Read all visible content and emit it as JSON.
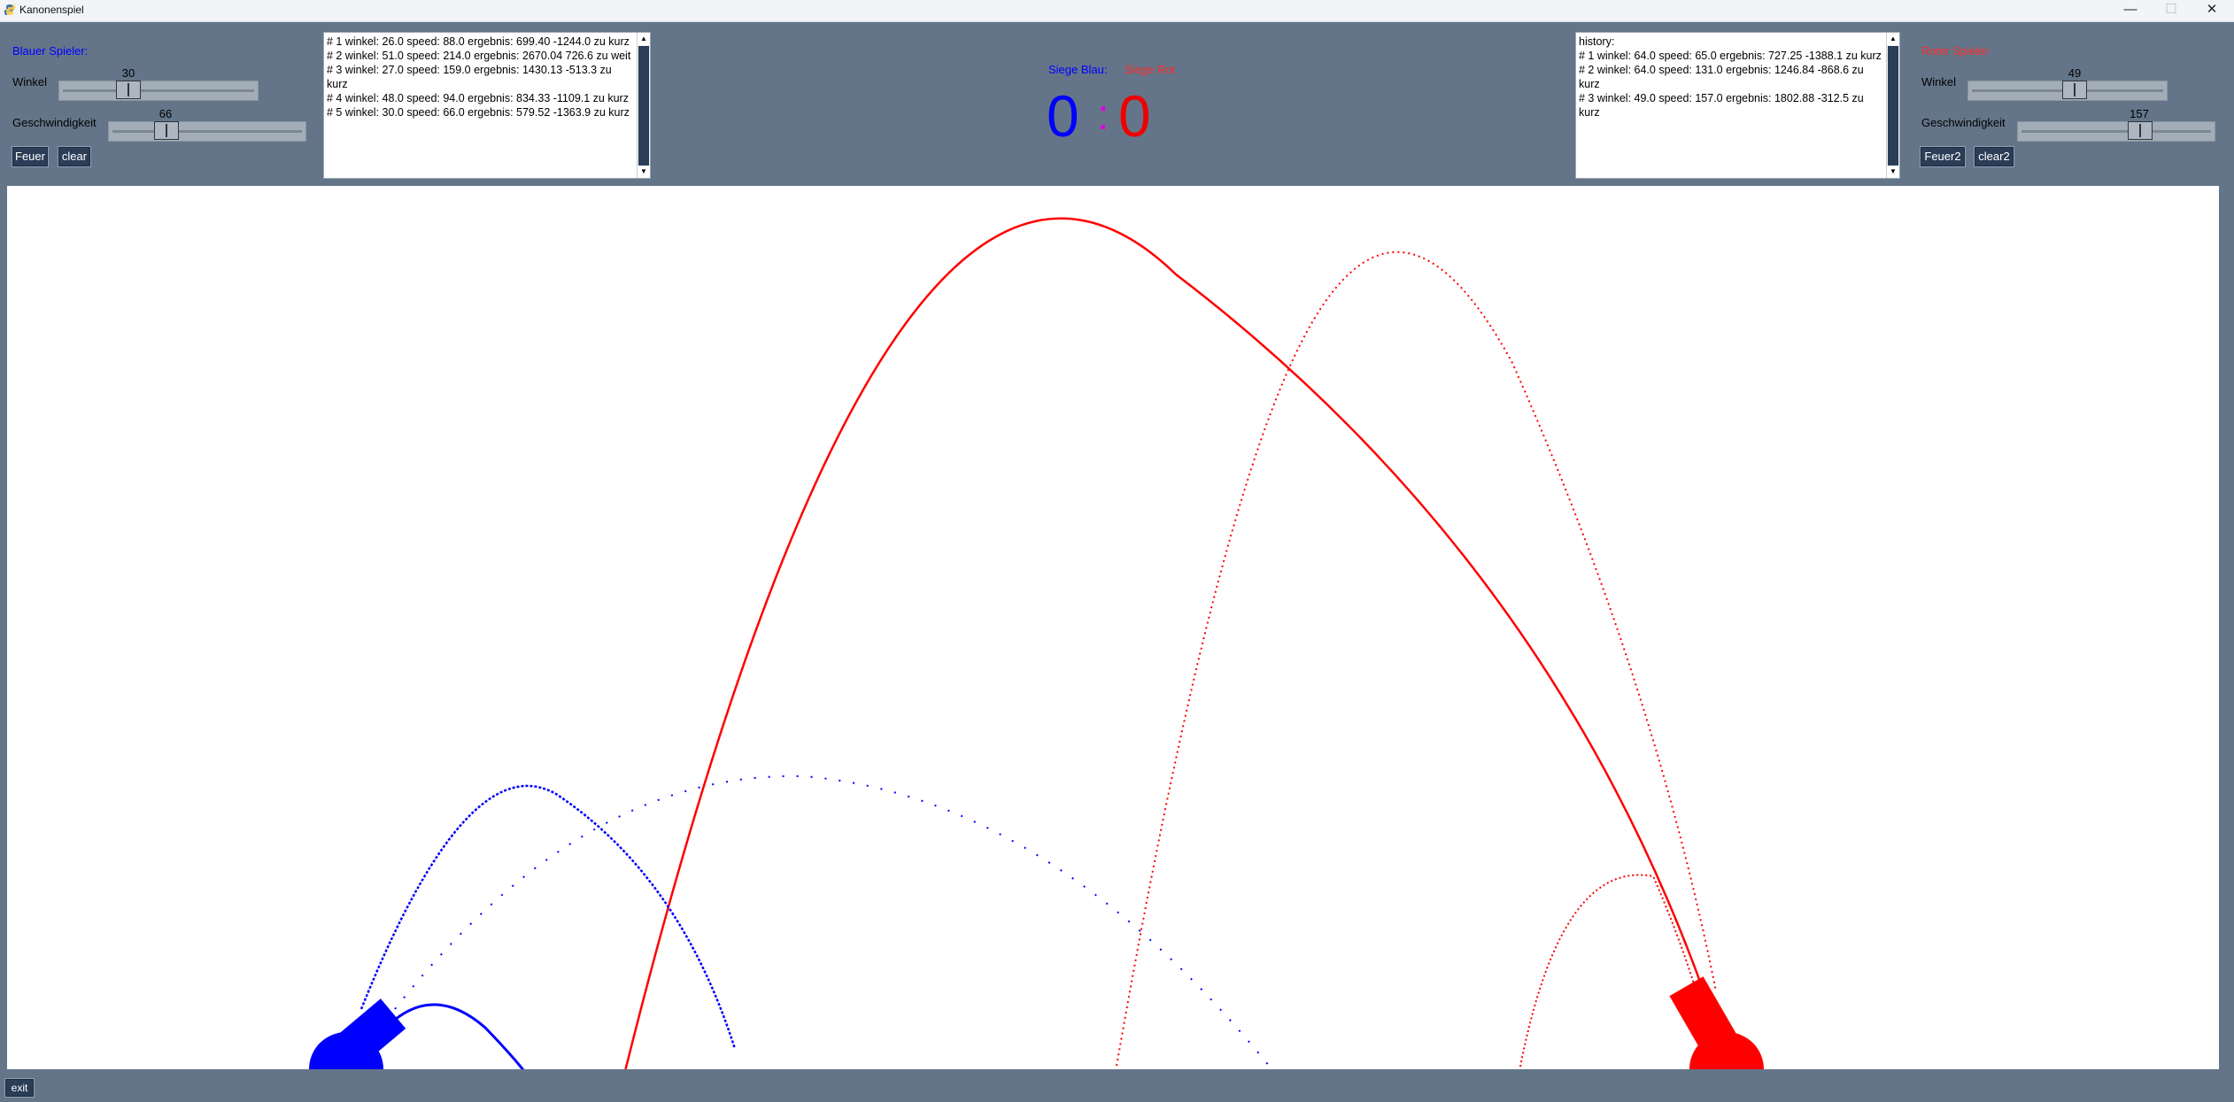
{
  "window": {
    "title": "Kanonenspiel",
    "controls": [
      "—",
      "☐",
      "✕"
    ]
  },
  "blue": {
    "header": "Blauer Spieler:",
    "angle_label": "Winkel",
    "angle_value": "30",
    "angle": {
      "value": 30,
      "min": 0,
      "max": 90
    },
    "speed_label": "Geschwindigkeit",
    "speed_value": "66",
    "speed": {
      "value": 66,
      "min": 0,
      "max": 220
    },
    "fire_label": "Feuer",
    "clear_label": "clear",
    "history": [
      "# 1 winkel: 26.0 speed: 88.0 ergebnis: 699.40 -1244.0 zu kurz",
      "# 2 winkel: 51.0 speed: 214.0 ergebnis: 2670.04 726.6 zu weit",
      "# 3 winkel: 27.0 speed: 159.0 ergebnis: 1430.13 -513.3 zu kurz",
      "# 4 winkel: 48.0 speed: 94.0 ergebnis: 834.33 -1109.1 zu kurz",
      "# 5 winkel: 30.0 speed: 66.0 ergebnis: 579.52 -1363.9 zu kurz"
    ]
  },
  "red": {
    "header": "Roter Spieler",
    "angle_label": "Winkel",
    "angle_value": "49",
    "angle": {
      "value": 49,
      "min": 0,
      "max": 90
    },
    "speed_label": "Geschwindigkeit",
    "speed_value": "157",
    "speed": {
      "value": 157,
      "min": 0,
      "max": 220
    },
    "fire_label": "Feuer2",
    "clear_label": "clear2",
    "history": [
      "history:",
      "# 1 winkel: 64.0 speed: 65.0 ergebnis: 727.25 -1388.1 zu kurz",
      "# 2 winkel: 64.0 speed: 131.0 ergebnis: 1246.84 -868.6 zu kurz",
      "# 3 winkel: 49.0 speed: 157.0 ergebnis: 1802.88 -312.5 zu kurz"
    ]
  },
  "score": {
    "blue_label": "Siege Blau:",
    "red_label": "Siege Rot",
    "blue_wins": "0",
    "separator": ":",
    "red_wins": "0"
  },
  "footer": {
    "exit_label": "exit"
  },
  "colors": {
    "blue": "#0000ff",
    "red": "#ff0000",
    "panel": "#647589",
    "button": "#2b3d57",
    "separator": "#e000e0"
  }
}
